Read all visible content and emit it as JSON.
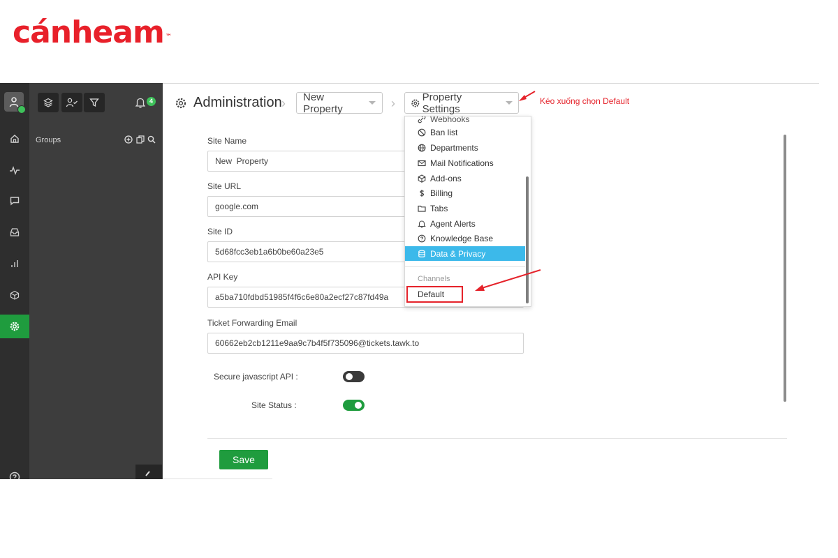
{
  "brand": {
    "logo_text": "cánheam",
    "trademark": "™"
  },
  "sidebar": {
    "groups_label": "Groups",
    "notification_count": "4",
    "nav_icons": [
      "home-icon",
      "activity-icon",
      "chat-icon",
      "inbox-icon",
      "reports-icon",
      "addons-icon",
      "settings-icon"
    ],
    "active_item": "settings-icon"
  },
  "header": {
    "title": "Administration",
    "property_select": "New Property",
    "section_select": "Property Settings",
    "annotation": "Kéo xuống chọn Default"
  },
  "form": {
    "site_name_label": "Site Name",
    "site_name_value": "New  Property",
    "site_url_label": "Site URL",
    "site_url_value": "google.com",
    "site_id_label": "Site ID",
    "site_id_value": "5d68fcc3eb1a6b0be60a23e5",
    "api_key_label": "API Key",
    "api_key_value": "a5ba710fdbd51985f4f6c6e80a2ecf27c87fd49a",
    "ticket_email_label": "Ticket Forwarding Email",
    "ticket_email_value": "60662eb2cb1211e9aa9c7b4f5f735096@tickets.tawk.to",
    "secure_js_label": "Secure javascript API :",
    "secure_js_enabled": false,
    "site_status_label": "Site Status :",
    "site_status_enabled": true,
    "save_label": "Save"
  },
  "dropdown": {
    "partial_item": "Webhooks",
    "items": [
      "Ban list",
      "Departments",
      "Mail Notifications",
      "Add-ons",
      "Billing",
      "Tabs",
      "Agent Alerts",
      "Knowledge Base",
      "Data & Privacy"
    ],
    "selected": "Data & Privacy",
    "group_label": "Channels",
    "channel_items": [
      "Default"
    ]
  },
  "colors": {
    "brand_red": "#e8202a",
    "accent_green": "#1f9c3e",
    "selected_blue": "#3cb9ea",
    "annotation_red": "#e5232b"
  }
}
